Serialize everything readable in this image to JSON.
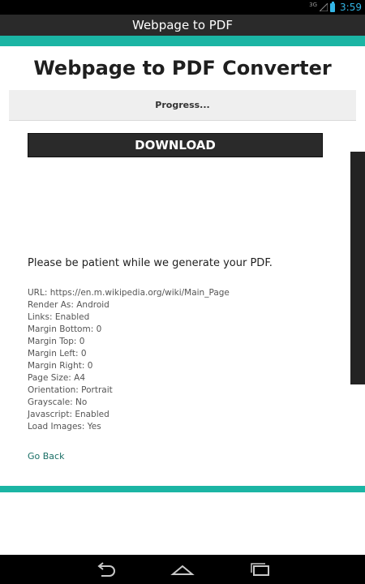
{
  "status_bar": {
    "network": "3G",
    "time": "3:59"
  },
  "app_bar": {
    "title": "Webpage to PDF"
  },
  "page": {
    "heading": "Webpage to PDF Converter",
    "progress_text": "Progress...",
    "download_label": "DOWNLOAD",
    "patient_message": "Please be patient while we generate your PDF.",
    "details": [
      "URL: https://en.m.wikipedia.org/wiki/Main_Page",
      "Render As: Android",
      "Links: Enabled",
      "Margin Bottom: 0",
      "Margin Top: 0",
      "Margin Left: 0",
      "Margin Right: 0",
      "Page Size: A4",
      "Orientation: Portrait",
      "Grayscale: No",
      "Javascript: Enabled",
      "Load Images: Yes"
    ],
    "go_back_label": "Go Back"
  },
  "nav_bar": {
    "back_icon": "back-icon",
    "home_icon": "home-icon",
    "recents_icon": "recents-icon"
  },
  "colors": {
    "accent": "#1bb5a4",
    "title_bar": "#2a2a2a",
    "status_blue": "#33b5e5",
    "link": "#1a6f66"
  }
}
